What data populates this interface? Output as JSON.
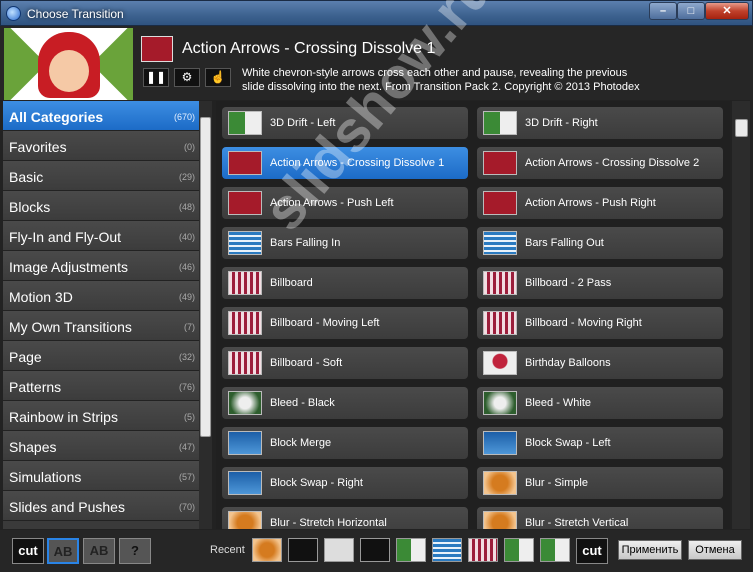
{
  "window": {
    "title": "Choose Transition",
    "controls": [
      "–",
      "□",
      "✕"
    ]
  },
  "header": {
    "name": "Action Arrows - Crossing Dissolve 1",
    "description": "White chevron-style arrows cross each other and pause, revealing the previous slide dissolving into the next. From Transition Pack 2. Copyright © 2013 Photodex",
    "buttons": {
      "pause": "❚❚",
      "settings": "⚙",
      "pointer": "☝"
    }
  },
  "categories": [
    {
      "label": "All Categories",
      "count": "(670)",
      "selected": true
    },
    {
      "label": "Favorites",
      "count": "(0)"
    },
    {
      "label": "Basic",
      "count": "(29)"
    },
    {
      "label": "Blocks",
      "count": "(48)"
    },
    {
      "label": "Fly-In and Fly-Out",
      "count": "(40)"
    },
    {
      "label": "Image Adjustments",
      "count": "(46)"
    },
    {
      "label": "Motion 3D",
      "count": "(49)"
    },
    {
      "label": "My Own Transitions",
      "count": "(7)"
    },
    {
      "label": "Page",
      "count": "(32)"
    },
    {
      "label": "Patterns",
      "count": "(76)"
    },
    {
      "label": "Rainbow in Strips",
      "count": "(5)"
    },
    {
      "label": "Shapes",
      "count": "(47)"
    },
    {
      "label": "Simulations",
      "count": "(57)"
    },
    {
      "label": "Slides and Pushes",
      "count": "(70)"
    }
  ],
  "transitions": [
    {
      "label": "3D Drift - Left",
      "icon": "green"
    },
    {
      "label": "3D Drift - Right",
      "icon": "green"
    },
    {
      "label": "Action Arrows - Crossing Dissolve 1",
      "icon": "red",
      "selected": true
    },
    {
      "label": "Action Arrows - Crossing Dissolve 2",
      "icon": "red"
    },
    {
      "label": "Action Arrows - Push Left",
      "icon": "red"
    },
    {
      "label": "Action Arrows - Push Right",
      "icon": "red"
    },
    {
      "label": "Bars Falling In",
      "icon": "bars"
    },
    {
      "label": "Bars Falling Out",
      "icon": "bars"
    },
    {
      "label": "Billboard",
      "icon": "bill"
    },
    {
      "label": "Billboard - 2 Pass",
      "icon": "bill"
    },
    {
      "label": "Billboard - Moving Left",
      "icon": "bill"
    },
    {
      "label": "Billboard - Moving Right",
      "icon": "bill"
    },
    {
      "label": "Billboard - Soft",
      "icon": "bill"
    },
    {
      "label": "Birthday Balloons",
      "icon": "balloon"
    },
    {
      "label": "Bleed - Black",
      "icon": "bleed"
    },
    {
      "label": "Bleed - White",
      "icon": "bleed"
    },
    {
      "label": "Block Merge",
      "icon": "block"
    },
    {
      "label": "Block Swap - Left",
      "icon": "block"
    },
    {
      "label": "Block Swap - Right",
      "icon": "block"
    },
    {
      "label": "Blur - Simple",
      "icon": "blur"
    },
    {
      "label": "Blur - Stretch Horizontal",
      "icon": "blur"
    },
    {
      "label": "Blur - Stretch Vertical",
      "icon": "blur"
    }
  ],
  "watermark": "slidshow.ru",
  "bottom": {
    "cut": "cut",
    "ab1": "AB",
    "ab2": "AB",
    "help": "?",
    "recent_label": "Recent",
    "recent_cut": "cut",
    "apply": "Применить",
    "cancel": "Отмена"
  }
}
